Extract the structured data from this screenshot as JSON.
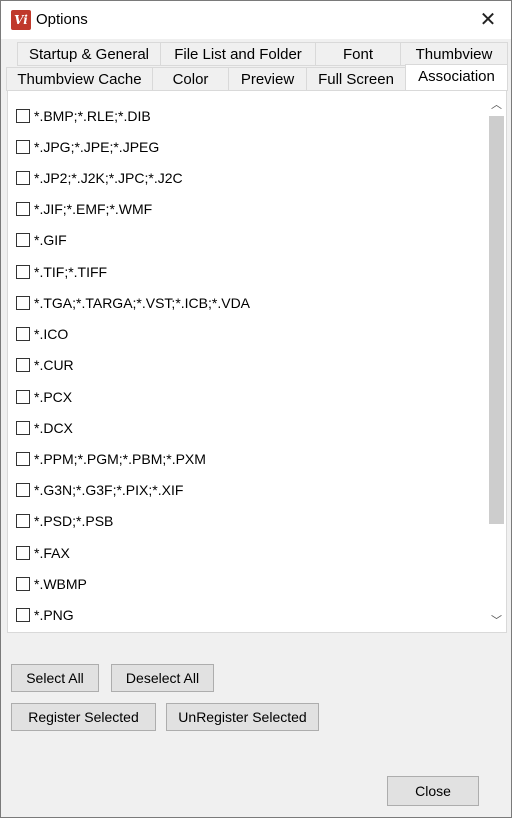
{
  "window": {
    "title": "Options",
    "app_icon_text": "Vi"
  },
  "tabs_row1": [
    "Startup & General",
    "File List and Folder",
    "Font",
    "Thumbview"
  ],
  "tabs_row2": [
    "Thumbview Cache",
    "Color",
    "Preview",
    "Full Screen",
    "Association"
  ],
  "active_tab": "Association",
  "file_types": [
    "*.BMP;*.RLE;*.DIB",
    "*.JPG;*.JPE;*.JPEG",
    "*.JP2;*.J2K;*.JPC;*.J2C",
    "*.JIF;*.EMF;*.WMF",
    "*.GIF",
    "*.TIF;*.TIFF",
    "*.TGA;*.TARGA;*.VST;*.ICB;*.VDA",
    "*.ICO",
    "*.CUR",
    "*.PCX",
    "*.DCX",
    "*.PPM;*.PGM;*.PBM;*.PXM",
    "*.G3N;*.G3F;*.PIX;*.XIF",
    "*.PSD;*.PSB",
    "*.FAX",
    "*.WBMP",
    "*.PNG"
  ],
  "buttons": {
    "select_all": "Select All",
    "deselect_all": "Deselect All",
    "register_selected": "Register Selected",
    "unregister_selected": "UnRegister Selected",
    "close": "Close"
  },
  "icons": {
    "close": "close-icon",
    "scroll_up": "chevron-up-icon",
    "scroll_down": "chevron-down-icon"
  }
}
